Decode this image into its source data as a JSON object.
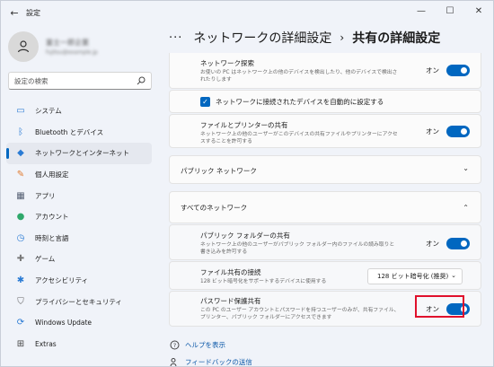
{
  "window": {
    "title": "設定",
    "back_glyph": "←",
    "controls": {
      "minimize": "—",
      "maximize": "☐",
      "close": "✕"
    }
  },
  "user": {
    "name": "富士一郎企業",
    "email": "fujitsu@example.jp"
  },
  "search": {
    "placeholder": "設定の検索"
  },
  "nav": [
    {
      "label": "システム",
      "icon": "monitor-icon",
      "glyph": "▭",
      "color": "#2a7bd4"
    },
    {
      "label": "Bluetooth とデバイス",
      "icon": "bluetooth-icon",
      "glyph": "ᛒ",
      "color": "#2a7bd4"
    },
    {
      "label": "ネットワークとインターネット",
      "icon": "wifi-icon",
      "glyph": "◆",
      "color": "#2a7bd4",
      "active": true
    },
    {
      "label": "個人用設定",
      "icon": "brush-icon",
      "glyph": "✎",
      "color": "#e07a2e"
    },
    {
      "label": "アプリ",
      "icon": "apps-icon",
      "glyph": "▦",
      "color": "#555f73"
    },
    {
      "label": "アカウント",
      "icon": "account-icon",
      "glyph": "●",
      "color": "#2fa86b"
    },
    {
      "label": "時刻と言語",
      "icon": "globe-clock-icon",
      "glyph": "◷",
      "color": "#2a7bd4"
    },
    {
      "label": "ゲーム",
      "icon": "gamepad-icon",
      "glyph": "✚",
      "color": "#777"
    },
    {
      "label": "アクセシビリティ",
      "icon": "accessibility-icon",
      "glyph": "✱",
      "color": "#2a7bd4"
    },
    {
      "label": "プライバシーとセキュリティ",
      "icon": "shield-icon",
      "glyph": "⛉",
      "color": "#666"
    },
    {
      "label": "Windows Update",
      "icon": "update-icon",
      "glyph": "⟳",
      "color": "#2a7bd4"
    },
    {
      "label": "Extras",
      "icon": "extras-icon",
      "glyph": "⊞",
      "color": "#444"
    }
  ],
  "breadcrumb": {
    "dots": "···",
    "parent": "ネットワークの詳細設定",
    "separator": "›",
    "current": "共有の詳細設定"
  },
  "main": {
    "network_discovery": {
      "title": "ネットワーク探索",
      "desc": "お使いの PC はネットワーク上の他のデバイスを検出したり、他のデバイスで検出されたりします",
      "toggle_label": "オン"
    },
    "auto_setup": {
      "label": "ネットワークに接続されたデバイスを自動的に設定する",
      "check_glyph": "✓"
    },
    "file_printer_sharing": {
      "title": "ファイルとプリンターの共有",
      "desc": "ネットワーク上の他のユーザーがこのデバイスの共有ファイルやプリンターにアクセスすることを許可する",
      "toggle_label": "オン"
    },
    "public_network": {
      "title": "パブリック ネットワーク",
      "chevron": "⌄"
    },
    "all_networks": {
      "title": "すべてのネットワーク",
      "chevron": "⌃"
    },
    "public_folder_sharing": {
      "title": "パブリック フォルダーの共有",
      "desc": "ネットワーク上の他のユーザーがパブリック フォルダー内のファイルの読み取りと書き込みを許可する",
      "toggle_label": "オン"
    },
    "file_sharing_connection": {
      "title": "ファイル共有の接続",
      "desc": "128 ビット暗号化をサポートするデバイスに使用する",
      "selected": "128 ビット暗号化 (推奨)",
      "chevron": "⌄"
    },
    "password_protected_sharing": {
      "title": "パスワード保護共有",
      "desc": "この PC のユーザー アカウントとパスワードを持つユーザーのみが、共有ファイル、プリンター、パブリック フォルダーにアクセスできます",
      "toggle_label": "オン"
    }
  },
  "footer": {
    "help": "ヘルプを表示",
    "feedback": "フィードバックの送信"
  },
  "colors": {
    "accent": "#0067c0",
    "highlight": "#e0102c"
  }
}
